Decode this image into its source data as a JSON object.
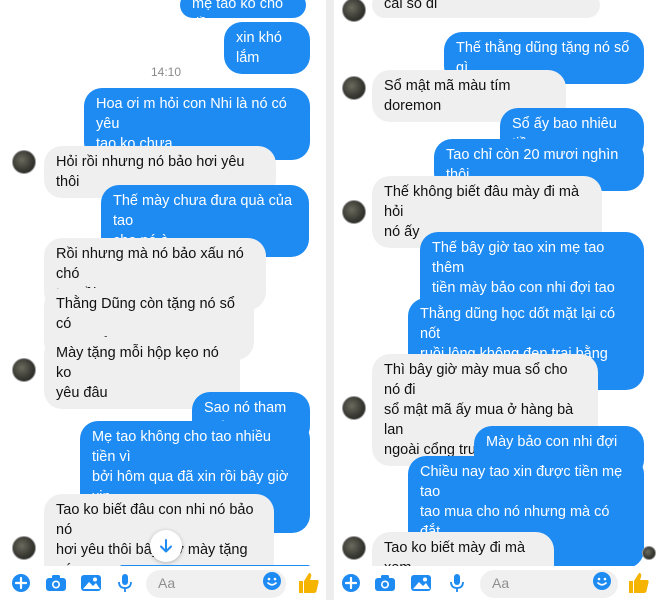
{
  "left": {
    "messages": [
      {
        "text": "mẹ tao ko cho tiền"
      },
      {
        "text": "xin khó lắm"
      },
      {
        "text": "Hoa ơi m hỏi con Nhi là nó có yêu\ntao ko chưa"
      },
      {
        "text": "Hỏi rồi nhưng nó bảo hơi yêu thôi"
      },
      {
        "text": "Thế mày chưa đưa quà của tao\ncho nó à"
      },
      {
        "text": "Rồi nhưng mà nó bảo xấu nó chó\ntao rồi"
      },
      {
        "text": "Thằng Dũng còn tặng nó sổ có\nmặt khẩu cơ"
      },
      {
        "text": "Mày tặng mỗi hộp kẹo nó ko\nyêu đâu"
      },
      {
        "text": "Sao nó tham thế"
      },
      {
        "text": "Mẹ tao không cho tao nhiều tiền vì\nbởi hôm qua đã xin rồi bây giờ xin\nnữa mẹ tao đánh"
      },
      {
        "text": "Tao ko biết đâu con nhi nó bảo nó\nhơi yêu thôi bây giờ mày tặng nó\ncái sổ đi"
      }
    ],
    "timestamp": "14:10",
    "input_placeholder": "Aa"
  },
  "right": {
    "messages": [
      {
        "text": "cái sổ đi"
      },
      {
        "text": "Thế thằng dũng tặng nó sổ gì"
      },
      {
        "text": "Sổ mật mã màu tím doremon"
      },
      {
        "text": "Sổ ấy bao nhiêu tiền"
      },
      {
        "text": "Tao chỉ còn 20 mươi nghìn thôi"
      },
      {
        "text": "Thế không biết đâu mày đi mà hỏi\nnó ấy"
      },
      {
        "text": "Thế bây giờ tao xin mẹ tao thêm\ntiền mày bảo con nhi đợi tao nhé\nđừng yêu thằng dũng"
      },
      {
        "text": "Thằng dũng học dốt mặt lại có nốt\nruồi lông không đẹp trai bằng tao"
      },
      {
        "text": "Thì bây giờ mày mua sổ cho nó đi\nsổ mật mã ấy mua ở hàng bà lan\nngoài cổng trường cũng được"
      },
      {
        "text": "Mày bảo con nhi đợi tao"
      },
      {
        "text": "Chiều nay tao xin được tiền mẹ tao\ntao mua cho nó nhưng mà có đắt\nkhông"
      },
      {
        "text": "Tao ko biết mày đi mà xem"
      }
    ],
    "input_placeholder": "Aa"
  },
  "colors": {
    "outgoing": "#1e8bf3",
    "incoming": "#efefef",
    "accent": "#1e8bf3",
    "like": "#f5b400"
  },
  "icons": [
    "plus-icon",
    "camera-icon",
    "image-icon",
    "mic-icon",
    "emoji-icon",
    "thumbs-up-icon",
    "arrow-down-icon"
  ]
}
